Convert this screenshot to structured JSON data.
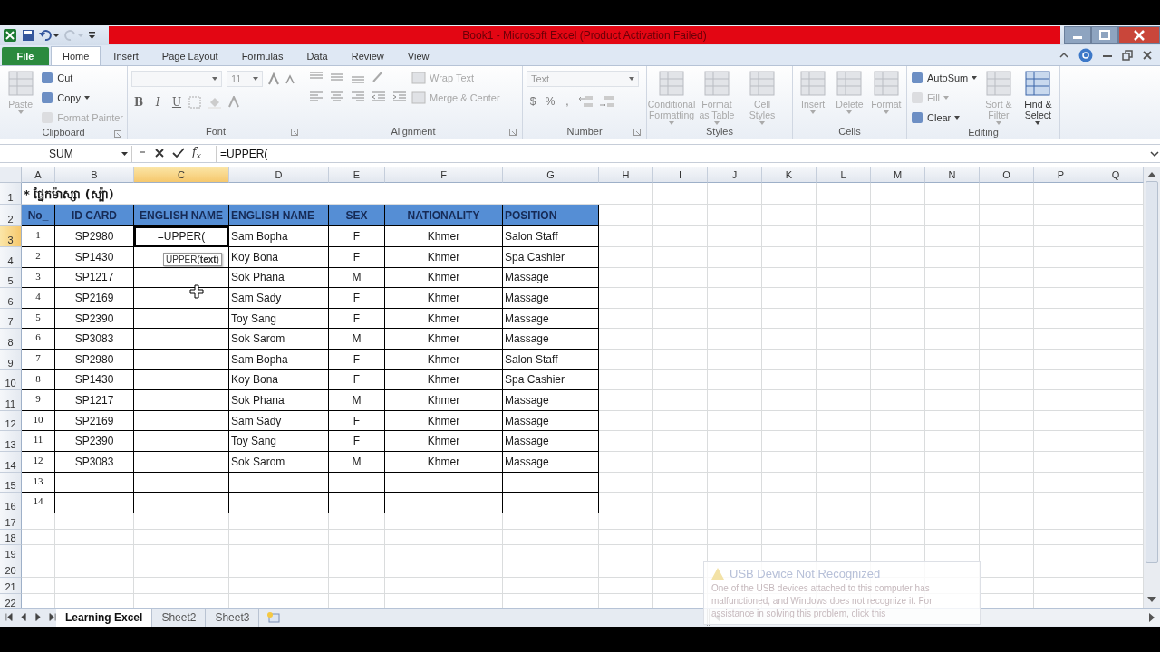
{
  "window": {
    "title": "Book1  -  Microsoft Excel (Product Activation Failed)"
  },
  "ribbon_tabs": [
    {
      "label": "File",
      "kind": "file",
      "selected": false
    },
    {
      "label": "Home",
      "kind": "tab",
      "selected": true
    },
    {
      "label": "Insert",
      "kind": "tab",
      "selected": false
    },
    {
      "label": "Page Layout",
      "kind": "tab",
      "selected": false
    },
    {
      "label": "Formulas",
      "kind": "tab",
      "selected": false
    },
    {
      "label": "Data",
      "kind": "tab",
      "selected": false
    },
    {
      "label": "Review",
      "kind": "tab",
      "selected": false
    },
    {
      "label": "View",
      "kind": "tab",
      "selected": false
    }
  ],
  "ribbon_groups": [
    {
      "kind": "commands",
      "label": "Clipboard",
      "launcher": true,
      "columns": [
        {
          "kind": "large",
          "label": "Paste",
          "disabled": true,
          "menu": true
        },
        {
          "kind": "stack",
          "items": [
            {
              "label": "Cut",
              "disabled": false,
              "menu": false
            },
            {
              "label": "Copy",
              "disabled": false,
              "menu": true
            },
            {
              "label": "Format Painter",
              "disabled": true,
              "menu": false
            }
          ]
        }
      ]
    },
    {
      "kind": "font",
      "label": "Font",
      "launcher": true,
      "font_size": "11",
      "format_buttons": [
        "B",
        "I",
        "U"
      ]
    },
    {
      "kind": "alignment",
      "label": "Alignment",
      "launcher": true,
      "commands": [
        {
          "label": "Wrap Text",
          "disabled": true
        },
        {
          "label": "Merge & Center",
          "disabled": true
        }
      ]
    },
    {
      "kind": "number",
      "label": "Number",
      "launcher": true,
      "format": "Text",
      "symbols": [
        "$",
        "%",
        ","
      ]
    },
    {
      "kind": "commands",
      "label": "Styles",
      "launcher": false,
      "columns": [
        {
          "kind": "large",
          "label": "Conditional Formatting",
          "disabled": true,
          "menu": true
        },
        {
          "kind": "large",
          "label": "Format as Table",
          "disabled": true,
          "menu": true
        },
        {
          "kind": "large",
          "label": "Cell Styles",
          "disabled": true,
          "menu": true
        }
      ]
    },
    {
      "kind": "commands",
      "label": "Cells",
      "launcher": false,
      "columns": [
        {
          "kind": "large",
          "label": "Insert",
          "disabled": true,
          "menu": true
        },
        {
          "kind": "large",
          "label": "Delete",
          "disabled": true,
          "menu": true
        },
        {
          "kind": "large",
          "label": "Format",
          "disabled": true,
          "menu": true
        }
      ]
    },
    {
      "kind": "commands",
      "label": "Editing",
      "launcher": false,
      "columns": [
        {
          "kind": "stack",
          "items": [
            {
              "label": "AutoSum",
              "disabled": false,
              "menu": true
            },
            {
              "label": "Fill",
              "disabled": true,
              "menu": true
            },
            {
              "label": "Clear",
              "disabled": false,
              "menu": true
            }
          ]
        },
        {
          "kind": "large",
          "label": "Sort & Filter",
          "disabled": true,
          "menu": true
        },
        {
          "kind": "large",
          "label": "Find & Select",
          "disabled": false,
          "menu": true
        }
      ]
    }
  ],
  "formula_bar": {
    "name_box": "SUM",
    "function_label": "f$_{x}$",
    "formula": "=UPPER("
  },
  "sheet": {
    "columns": [
      {
        "label": "A",
        "selected": false
      },
      {
        "label": "B",
        "selected": false
      },
      {
        "label": "C",
        "selected": true
      },
      {
        "label": "D",
        "selected": false
      },
      {
        "label": "E",
        "selected": false
      },
      {
        "label": "F",
        "selected": false
      },
      {
        "label": "G",
        "selected": false
      },
      {
        "label": "H",
        "selected": false
      },
      {
        "label": "I",
        "selected": false
      },
      {
        "label": "J",
        "selected": false
      },
      {
        "label": "K",
        "selected": false
      },
      {
        "label": "L",
        "selected": false
      },
      {
        "label": "M",
        "selected": false
      },
      {
        "label": "N",
        "selected": false
      },
      {
        "label": "O",
        "selected": false
      },
      {
        "label": "P",
        "selected": false
      },
      {
        "label": "Q",
        "selected": false
      }
    ],
    "rows": [
      {
        "number": "1",
        "selected": false,
        "kind": "title",
        "title": "* ផ្នែកម៉ាស្សា (ស្ប៉ា)"
      },
      {
        "number": "2",
        "selected": false,
        "kind": "header",
        "cells": {
          "A": "No_",
          "B": "ID CARD",
          "C": "ENGLISH NAME",
          "D": "ENGLISH NAME",
          "E": "SEX",
          "F": "NATIONALITY",
          "G": "POSITION"
        }
      },
      {
        "number": "3",
        "selected": true,
        "kind": "data",
        "cells": {
          "A": "1",
          "B": "SP2980",
          "C": "=UPPER(",
          "D": "Sam Bopha",
          "E": "F",
          "F": "Khmer",
          "G": "Salon Staff"
        }
      },
      {
        "number": "4",
        "selected": false,
        "kind": "data",
        "cells": {
          "A": "2",
          "B": "SP1430",
          "D": "Koy Bona",
          "E": "F",
          "F": "Khmer",
          "G": "Spa Cashier"
        }
      },
      {
        "number": "5",
        "selected": false,
        "kind": "data",
        "cells": {
          "A": "3",
          "B": "SP1217",
          "D": "Sok Phana",
          "E": "M",
          "F": "Khmer",
          "G": "Massage"
        }
      },
      {
        "number": "6",
        "selected": false,
        "kind": "data",
        "cells": {
          "A": "4",
          "B": "SP2169",
          "D": "Sam Sady",
          "E": "F",
          "F": "Khmer",
          "G": "Massage"
        }
      },
      {
        "number": "7",
        "selected": false,
        "kind": "data",
        "cells": {
          "A": "5",
          "B": "SP2390",
          "D": "Toy Sang",
          "E": "F",
          "F": "Khmer",
          "G": "Massage"
        }
      },
      {
        "number": "8",
        "selected": false,
        "kind": "data",
        "cells": {
          "A": "6",
          "B": "SP3083",
          "D": "Sok Sarom",
          "E": "M",
          "F": "Khmer",
          "G": "Massage"
        }
      },
      {
        "number": "9",
        "selected": false,
        "kind": "data",
        "cells": {
          "A": "7",
          "B": "SP2980",
          "D": "Sam Bopha",
          "E": "F",
          "F": "Khmer",
          "G": "Salon Staff"
        }
      },
      {
        "number": "10",
        "selected": false,
        "kind": "data",
        "cells": {
          "A": "8",
          "B": "SP1430",
          "D": "Koy Bona",
          "E": "F",
          "F": "Khmer",
          "G": "Spa Cashier"
        }
      },
      {
        "number": "11",
        "selected": false,
        "kind": "data",
        "cells": {
          "A": "9",
          "B": "SP1217",
          "D": "Sok Phana",
          "E": "M",
          "F": "Khmer",
          "G": "Massage"
        }
      },
      {
        "number": "12",
        "selected": false,
        "kind": "data",
        "cells": {
          "A": "10",
          "B": "SP2169",
          "D": "Sam Sady",
          "E": "F",
          "F": "Khmer",
          "G": "Massage"
        }
      },
      {
        "number": "13",
        "selected": false,
        "kind": "data",
        "cells": {
          "A": "11",
          "B": "SP2390",
          "D": "Toy Sang",
          "E": "F",
          "F": "Khmer",
          "G": "Massage"
        }
      },
      {
        "number": "14",
        "selected": false,
        "kind": "data",
        "cells": {
          "A": "12",
          "B": "SP3083",
          "D": "Sok Sarom",
          "E": "M",
          "F": "Khmer",
          "G": "Massage"
        }
      },
      {
        "number": "15",
        "selected": false,
        "kind": "data",
        "cells": {
          "A": "13"
        }
      },
      {
        "number": "16",
        "selected": false,
        "kind": "data",
        "cells": {
          "A": "14"
        }
      },
      {
        "number": "17",
        "selected": false,
        "kind": "plain"
      },
      {
        "number": "18",
        "selected": false,
        "kind": "plain"
      },
      {
        "number": "19",
        "selected": false,
        "kind": "plain"
      },
      {
        "number": "20",
        "selected": false,
        "kind": "plain"
      },
      {
        "number": "21",
        "selected": false,
        "kind": "plain"
      },
      {
        "number": "22",
        "selected": false,
        "kind": "plain"
      }
    ],
    "tooltip": "UPPER(**text**)"
  },
  "sheet_tabs": [
    {
      "label": "Learning Excel",
      "selected": true
    },
    {
      "label": "Sheet2",
      "selected": false
    },
    {
      "label": "Sheet3",
      "selected": false
    }
  ],
  "notification": {
    "title": "USB Device Not Recognized",
    "message": "One of the USB devices attached to this computer has malfunctioned, and Windows does not recognize it. For assistance in solving this problem, click this"
  }
}
